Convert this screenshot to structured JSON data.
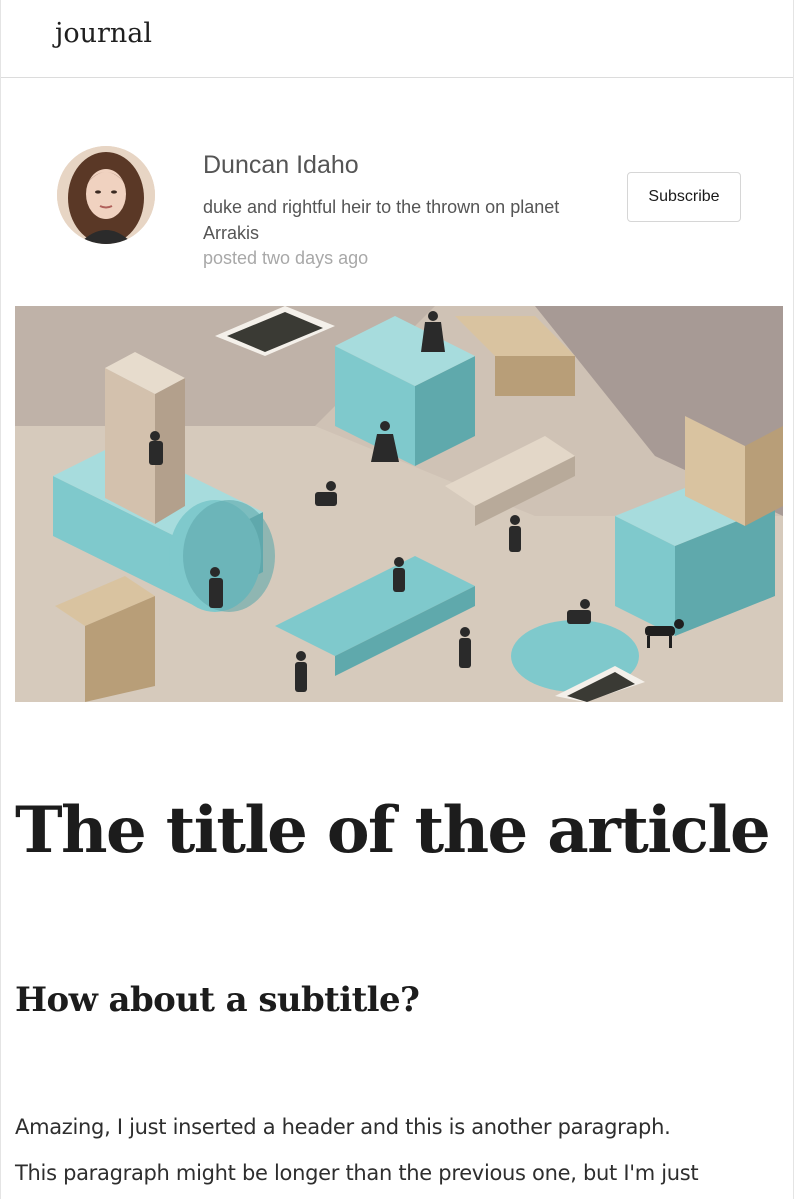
{
  "header": {
    "brand": "journal"
  },
  "author": {
    "name": "Duncan Idaho",
    "bio": "duke and rightful heir to the thrown on planet Arrakis",
    "posted": "posted two days ago",
    "subscribe_label": "Subscribe",
    "avatar_alt": "author-avatar"
  },
  "hero": {
    "alt": "isometric-illustration"
  },
  "article": {
    "title": "The title of the article",
    "subtitle": "How about a subtitle?",
    "paragraphs": [
      "Amazing, I just inserted a header and this is another paragraph.",
      "This paragraph might be longer than the previous one, but I'm just"
    ]
  },
  "colors": {
    "text": "#2a2a2a",
    "muted": "#a8a8a8",
    "border": "#dcdcdc",
    "hero_teal": "#7fc9cc",
    "hero_sand": "#d9c3a0"
  }
}
